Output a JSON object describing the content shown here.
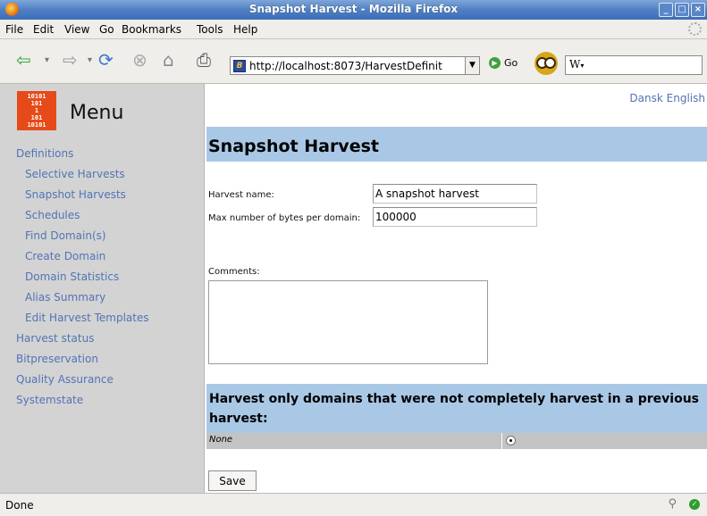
{
  "window": {
    "title": "Snapshot Harvest - Mozilla Firefox"
  },
  "menubar": [
    "File",
    "Edit",
    "View",
    "Go",
    "Bookmarks",
    "Tools",
    "Help"
  ],
  "toolbar": {
    "url": "http://localhost:8073/HarvestDefinit",
    "go_label": "Go",
    "search_value": "W"
  },
  "sidebar": {
    "title": "Menu",
    "logo_text": "10101 101 1 101 10101",
    "items": [
      {
        "label": "Definitions",
        "level": 0
      },
      {
        "label": "Selective Harvests",
        "level": 1
      },
      {
        "label": "Snapshot Harvests",
        "level": 1
      },
      {
        "label": "Schedules",
        "level": 1
      },
      {
        "label": "Find Domain(s)",
        "level": 1
      },
      {
        "label": "Create Domain",
        "level": 1
      },
      {
        "label": "Domain Statistics",
        "level": 1
      },
      {
        "label": "Alias Summary",
        "level": 1
      },
      {
        "label": "Edit Harvest Templates",
        "level": 1
      },
      {
        "label": "Harvest status",
        "level": 0
      },
      {
        "label": "Bitpreservation",
        "level": 0
      },
      {
        "label": "Quality Assurance",
        "level": 0
      },
      {
        "label": "Systemstate",
        "level": 0
      }
    ]
  },
  "content": {
    "languages": [
      "Dansk",
      "English"
    ],
    "page_title": "Snapshot Harvest",
    "form": {
      "harvest_name_label": "Harvest name:",
      "harvest_name_value": "A snapshot harvest",
      "max_bytes_label": "Max number of bytes per domain:",
      "max_bytes_value": "100000",
      "comments_label": "Comments:",
      "comments_value": ""
    },
    "previous_section_title": "Harvest only domains that were not completely harvest in a previous harvest:",
    "previous_rows": [
      {
        "name": "None",
        "selected": true
      }
    ],
    "save_label": "Save"
  },
  "status": {
    "text": "Done"
  },
  "colors": {
    "accent": "#a9c8e6",
    "link": "#5273b6",
    "sidebar": "#d3d3d3",
    "logo": "#e64a19"
  }
}
